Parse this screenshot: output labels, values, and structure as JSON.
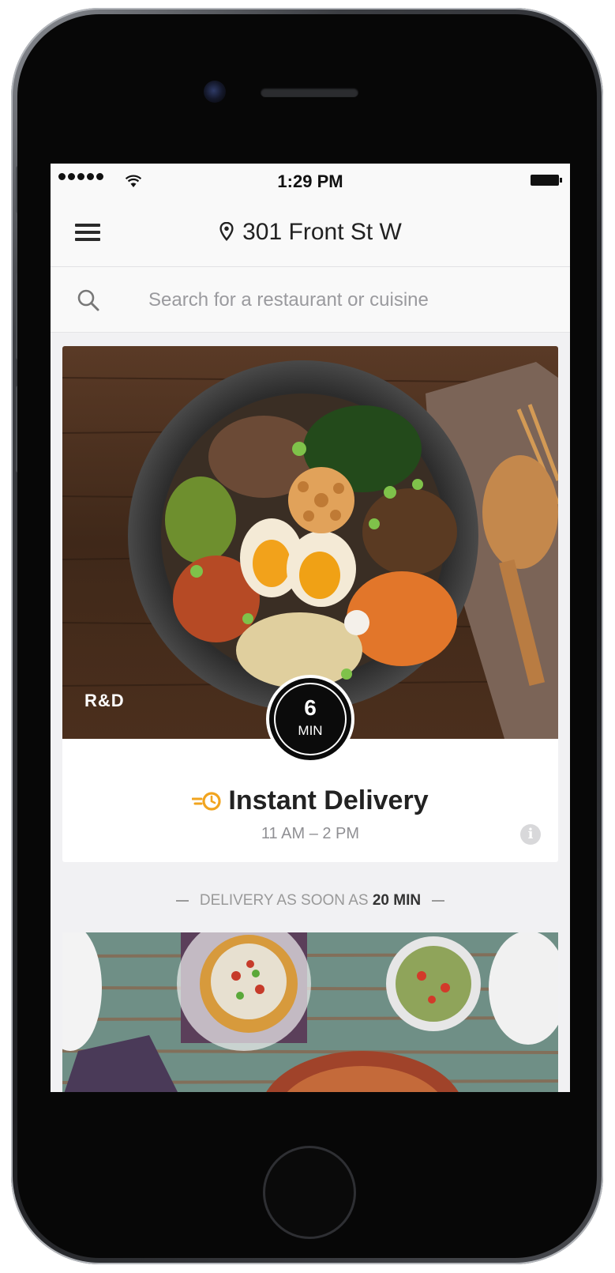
{
  "status_bar": {
    "signal_dots": 5,
    "time": "1:29 PM"
  },
  "nav": {
    "location": "301 Front St W"
  },
  "search": {
    "placeholder": "Search for a restaurant or cuisine"
  },
  "featured": {
    "brand": "R&D",
    "eta_value": "6",
    "eta_unit": "MIN",
    "title": "Instant Delivery",
    "hours": "11 AM – 2 PM"
  },
  "divider": {
    "prefix": "DELIVERY AS SOON AS",
    "highlight": "20 MIN"
  },
  "colors": {
    "accent": "#f1a41f",
    "eta_badge": "#0b0b0b"
  }
}
